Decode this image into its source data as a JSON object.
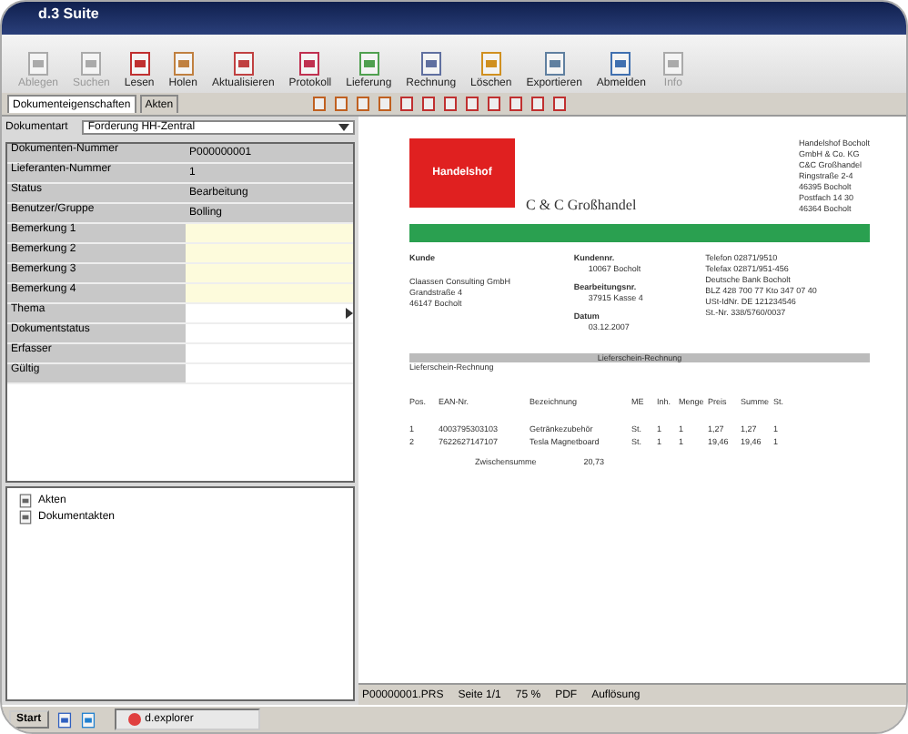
{
  "window": {
    "title": "d.3 Suite"
  },
  "toolbar": [
    {
      "label": "Ablegen",
      "disabled": true
    },
    {
      "label": "Suchen",
      "disabled": true
    },
    {
      "label": "Lesen",
      "disabled": false
    },
    {
      "label": "Holen",
      "disabled": false
    },
    {
      "label": "Aktualisieren",
      "disabled": false
    },
    {
      "label": "Protokoll",
      "disabled": false
    },
    {
      "label": "Lieferung",
      "disabled": false
    },
    {
      "label": "Rechnung",
      "disabled": false
    },
    {
      "label": "Löschen",
      "disabled": false
    },
    {
      "label": "Exportieren",
      "disabled": false
    },
    {
      "label": "Abmelden",
      "disabled": false
    },
    {
      "label": "Info",
      "disabled": true
    }
  ],
  "tabs": [
    {
      "label": "Dokumenteigenschaften",
      "selected": true
    },
    {
      "label": "Akten",
      "selected": false
    }
  ],
  "doc_type": {
    "label": "Dokumentart",
    "value": "Forderung HH-Zentral"
  },
  "properties": [
    {
      "name": "Dokumenten-Nummer",
      "kind": "readonly",
      "value": "P000000001"
    },
    {
      "name": "Lieferanten-Nummer",
      "kind": "readonly",
      "value": "1"
    },
    {
      "name": "Status",
      "kind": "readonly",
      "value": "Bearbeitung"
    },
    {
      "name": "Benutzer/Gruppe",
      "kind": "readonly",
      "value": "Bolling"
    },
    {
      "name": "Bemerkung 1",
      "kind": "note"
    },
    {
      "name": "Bemerkung 2",
      "kind": "note"
    },
    {
      "name": "Bemerkung 3",
      "kind": "note"
    },
    {
      "name": "Bemerkung 4",
      "kind": "note"
    },
    {
      "name": "Thema",
      "kind": "dropdown"
    },
    {
      "name": "Dokumentstatus",
      "kind": "plain"
    },
    {
      "name": "Erfasser",
      "kind": "plain"
    },
    {
      "name": "Gültig",
      "kind": "plain"
    }
  ],
  "tree": [
    {
      "label": "Akten"
    },
    {
      "label": "Dokumentakten"
    }
  ],
  "document": {
    "logo": "Handelshof",
    "company": "C & C Großhandel",
    "address": [
      "Handelshof Bocholt",
      "GmbH & Co. KG",
      "C&C Großhandel",
      "Ringstraße 2-4",
      "46395 Bocholt",
      "Postfach 14 30",
      "46364 Bocholt"
    ],
    "customer_label": "Kunde",
    "customer": [
      "Claassen Consulting GmbH",
      "Grandstraße 4",
      "46147 Bocholt"
    ],
    "meta": [
      {
        "label": "Kundennr.",
        "value": "10067 Bocholt"
      },
      {
        "label": "Bearbeitungsnr.",
        "value": "37915 Kasse 4"
      },
      {
        "label": "Datum",
        "value": "03.12.2007"
      }
    ],
    "contact": [
      "Telefon 02871/9510",
      "Telefax 02871/951-456",
      "Deutsche Bank Bocholt",
      "BLZ 428 700 77 Kto 347 07 40",
      "USt-IdNr. DE 121234546",
      "St.-Nr. 338/5760/0037"
    ],
    "bar": "Lieferschein-Rechnung",
    "subtitle": "Lieferschein-Rechnung",
    "columns": [
      "Pos.",
      "EAN-Nr.",
      "Bezeichnung",
      "ME",
      "Inh.",
      "Menge",
      "Preis",
      "Summe",
      "St."
    ],
    "rows": [
      [
        "1",
        "4003795303103",
        "Getränkezubehör",
        "St.",
        "1",
        "1",
        "1,27",
        "1,27",
        "1"
      ],
      [
        "2",
        "7622627147107",
        "Tesla Magnetboard",
        "St.",
        "1",
        "1",
        "19,46",
        "19,46",
        "1"
      ]
    ],
    "subtotal_label": "Zwischensumme",
    "subtotal": "20,73"
  },
  "status_bar": [
    "P00000001.PRS",
    "Seite 1/1",
    "75 %",
    "PDF",
    "Auflösung"
  ],
  "taskbar": {
    "start": "Start",
    "task": "d.explorer"
  }
}
